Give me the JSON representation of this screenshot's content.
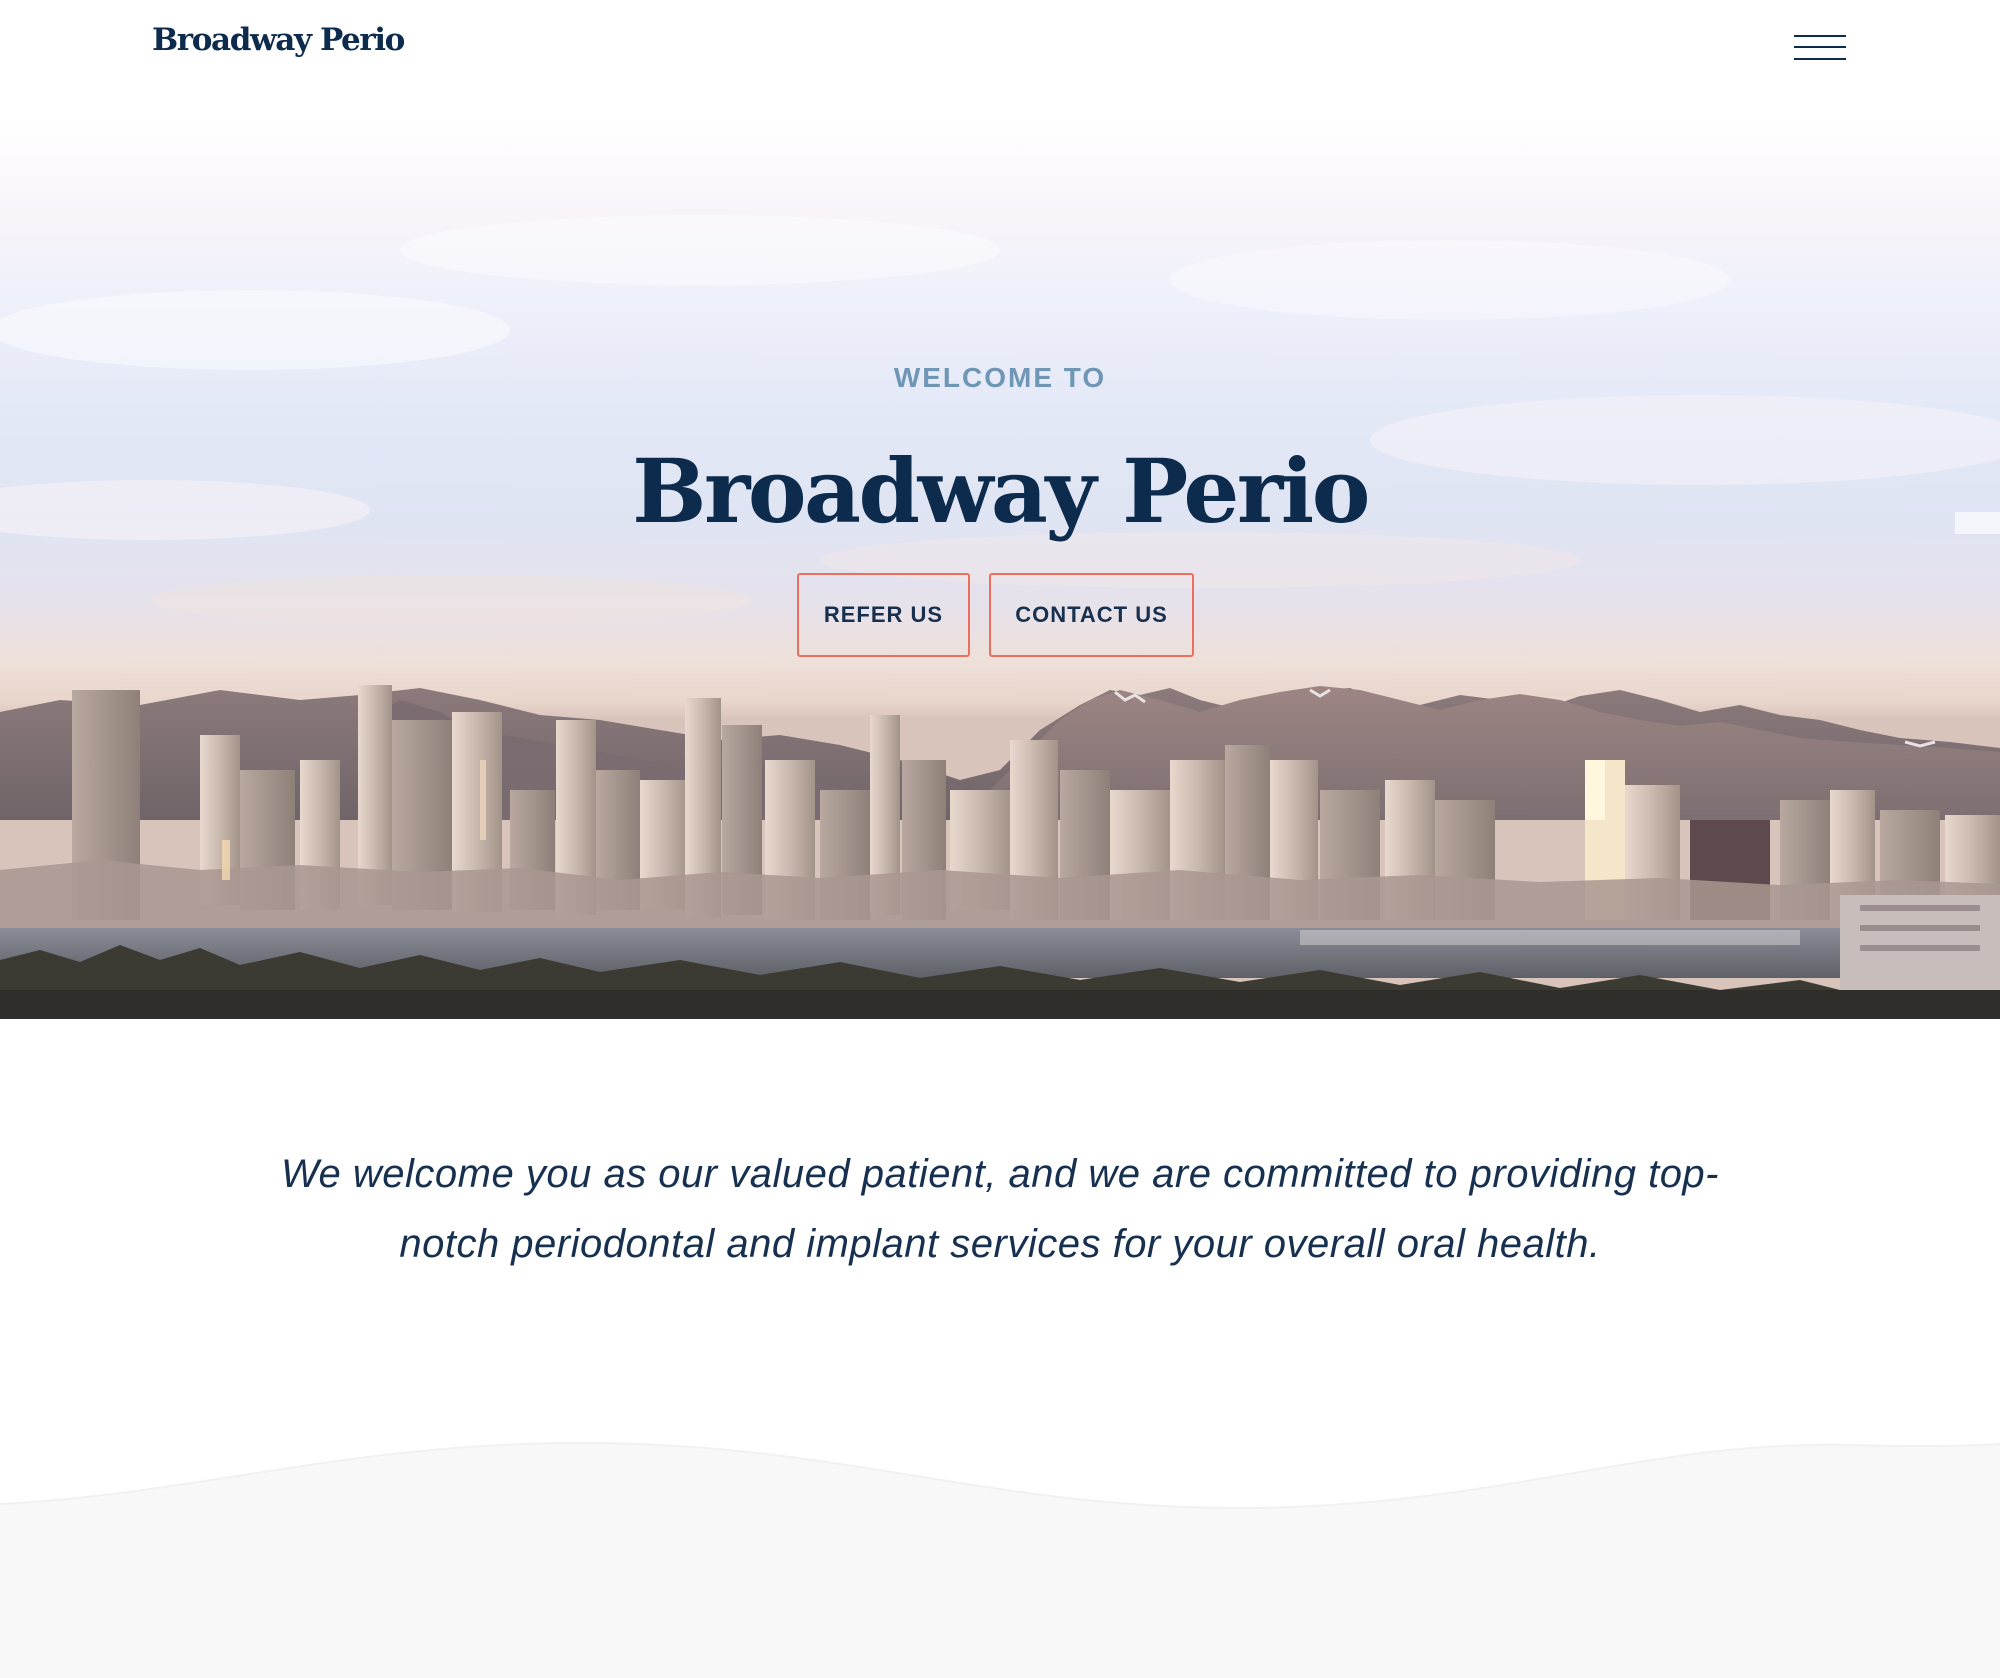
{
  "site": {
    "logo_text": "Broadway Perio",
    "menu_icon": "hamburger-menu-icon"
  },
  "hero": {
    "eyebrow": "WELCOME TO",
    "title": "Broadway Perio",
    "buttons": [
      {
        "label": "REFER US"
      },
      {
        "label": "CONTACT US"
      }
    ],
    "background_image": "vancouver-skyline-at-sunset"
  },
  "intro": {
    "text": "We welcome you as our valued patient, and we are committed to providing top-notch periodontal and implant services for your overall oral health."
  },
  "colors": {
    "navy": "#0d2b4d",
    "accent": "#e8705c",
    "eyebrow": "#6f97b5",
    "wave": "#f8f8f8"
  }
}
